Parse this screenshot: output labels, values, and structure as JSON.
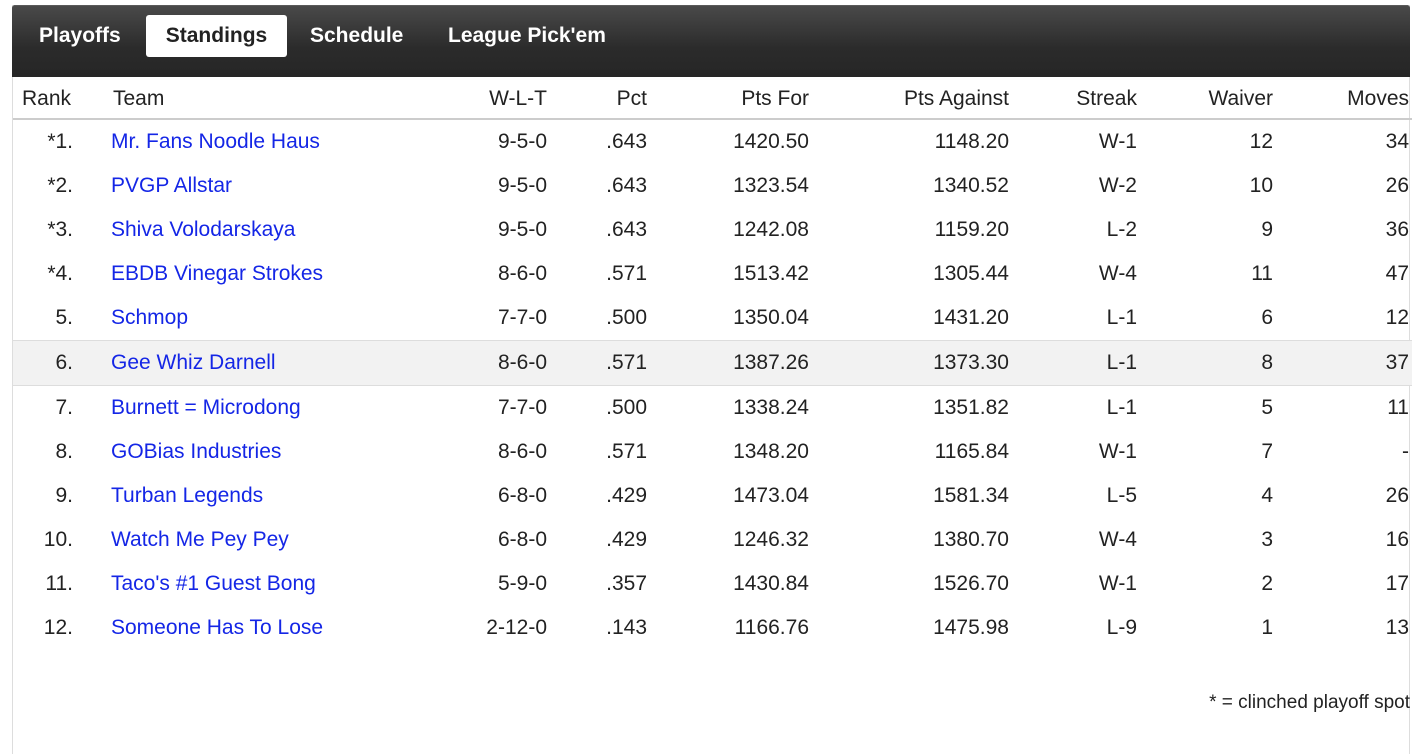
{
  "tabs": {
    "playoffs": "Playoffs",
    "standings": "Standings",
    "schedule": "Schedule",
    "pickem": "League Pick'em"
  },
  "columns": {
    "rank": "Rank",
    "team": "Team",
    "wlt": "W-L-T",
    "pct": "Pct",
    "pts_for": "Pts For",
    "pts_against": "Pts Against",
    "streak": "Streak",
    "waiver": "Waiver",
    "moves": "Moves"
  },
  "rows": [
    {
      "rank": "*1.",
      "team": "Mr. Fans Noodle Haus",
      "wlt": "9-5-0",
      "pct": ".643",
      "pts_for": "1420.50",
      "pts_against": "1148.20",
      "streak": "W-1",
      "waiver": "12",
      "moves": "34"
    },
    {
      "rank": "*2.",
      "team": "PVGP Allstar",
      "wlt": "9-5-0",
      "pct": ".643",
      "pts_for": "1323.54",
      "pts_against": "1340.52",
      "streak": "W-2",
      "waiver": "10",
      "moves": "26"
    },
    {
      "rank": "*3.",
      "team": "Shiva Volodarskaya",
      "wlt": "9-5-0",
      "pct": ".643",
      "pts_for": "1242.08",
      "pts_against": "1159.20",
      "streak": "L-2",
      "waiver": "9",
      "moves": "36"
    },
    {
      "rank": "*4.",
      "team": "EBDB Vinegar Strokes",
      "wlt": "8-6-0",
      "pct": ".571",
      "pts_for": "1513.42",
      "pts_against": "1305.44",
      "streak": "W-4",
      "waiver": "11",
      "moves": "47"
    },
    {
      "rank": "5.",
      "team": "Schmop",
      "wlt": "7-7-0",
      "pct": ".500",
      "pts_for": "1350.04",
      "pts_against": "1431.20",
      "streak": "L-1",
      "waiver": "6",
      "moves": "12"
    },
    {
      "rank": "6.",
      "team": "Gee Whiz Darnell",
      "wlt": "8-6-0",
      "pct": ".571",
      "pts_for": "1387.26",
      "pts_against": "1373.30",
      "streak": "L-1",
      "waiver": "8",
      "moves": "37"
    },
    {
      "rank": "7.",
      "team": "Burnett = Microdong",
      "wlt": "7-7-0",
      "pct": ".500",
      "pts_for": "1338.24",
      "pts_against": "1351.82",
      "streak": "L-1",
      "waiver": "5",
      "moves": "11"
    },
    {
      "rank": "8.",
      "team": "GOBias Industries",
      "wlt": "8-6-0",
      "pct": ".571",
      "pts_for": "1348.20",
      "pts_against": "1165.84",
      "streak": "W-1",
      "waiver": "7",
      "moves": "-"
    },
    {
      "rank": "9.",
      "team": "Turban Legends",
      "wlt": "6-8-0",
      "pct": ".429",
      "pts_for": "1473.04",
      "pts_against": "1581.34",
      "streak": "L-5",
      "waiver": "4",
      "moves": "26"
    },
    {
      "rank": "10.",
      "team": "Watch Me Pey Pey",
      "wlt": "6-8-0",
      "pct": ".429",
      "pts_for": "1246.32",
      "pts_against": "1380.70",
      "streak": "W-4",
      "waiver": "3",
      "moves": "16"
    },
    {
      "rank": "11.",
      "team": "Taco's #1 Guest Bong",
      "wlt": "5-9-0",
      "pct": ".357",
      "pts_for": "1430.84",
      "pts_against": "1526.70",
      "streak": "W-1",
      "waiver": "2",
      "moves": "17"
    },
    {
      "rank": "12.",
      "team": "Someone Has To Lose",
      "wlt": "2-12-0",
      "pct": ".143",
      "pts_for": "1166.76",
      "pts_against": "1475.98",
      "streak": "L-9",
      "waiver": "1",
      "moves": "13"
    }
  ],
  "footnote": "* = clinched playoff spot",
  "colors": {
    "link": "#1426e6",
    "tabbar": "#2b2b2b",
    "highlight_row": "#f2f2f2"
  }
}
